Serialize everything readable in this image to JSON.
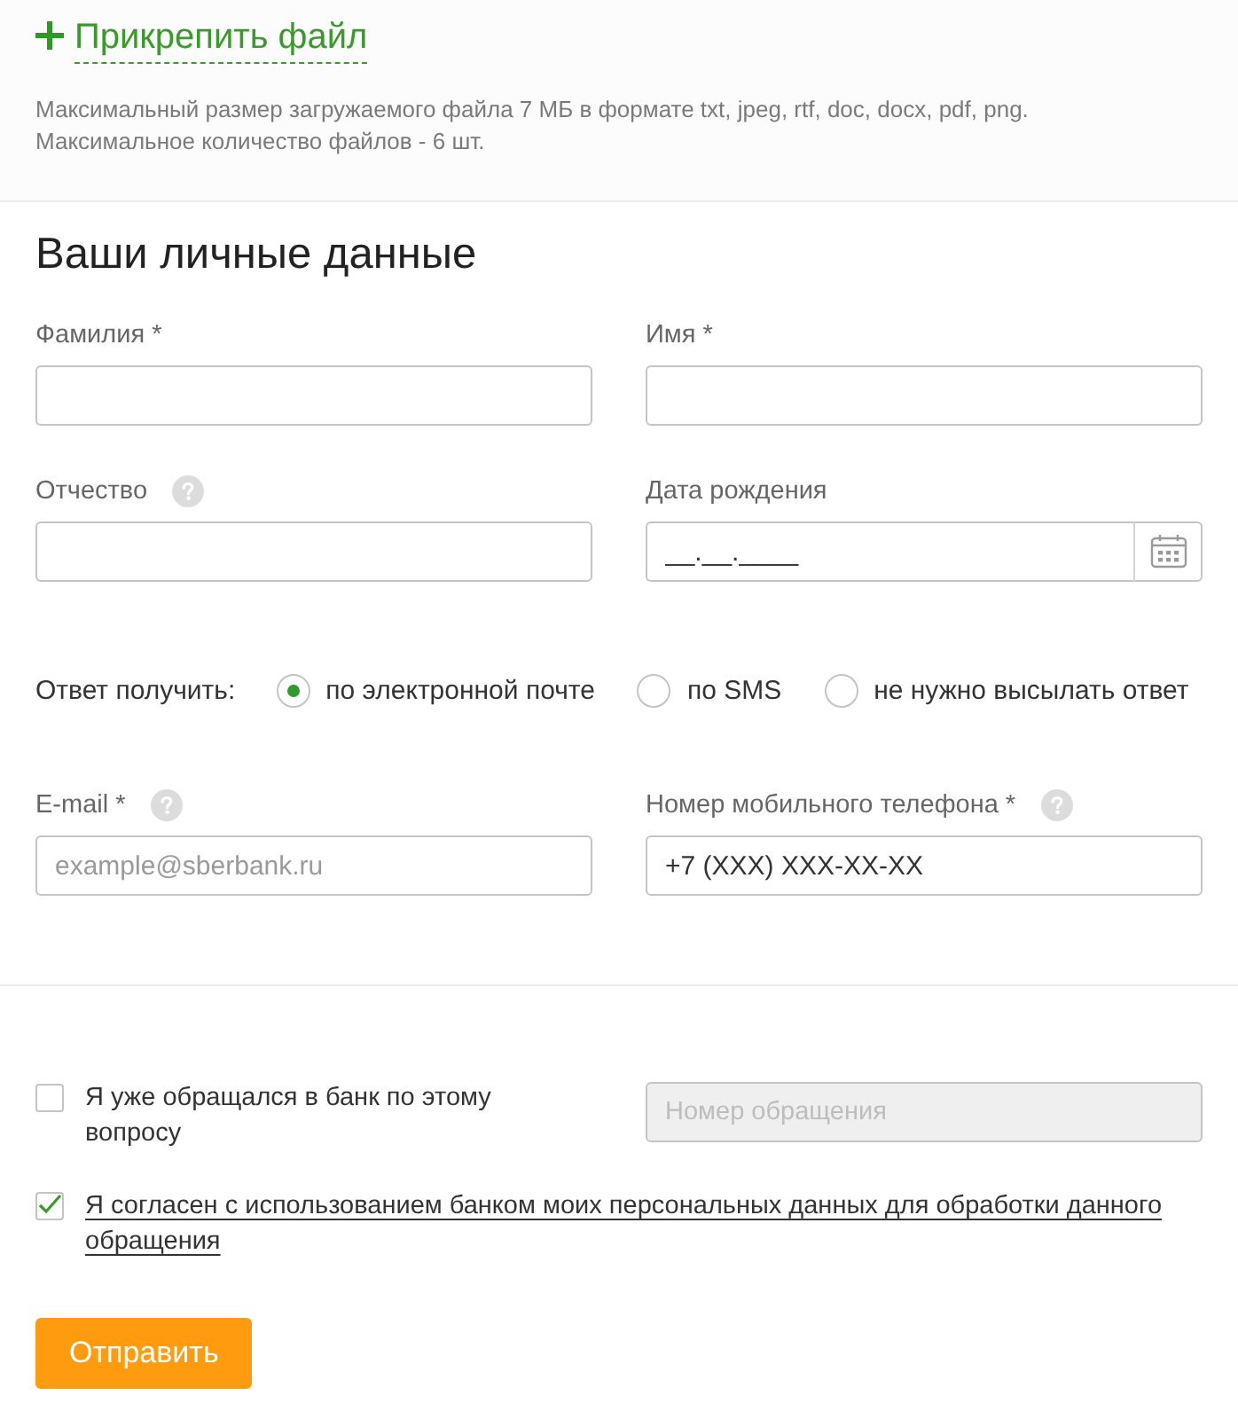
{
  "attach": {
    "label": "Прикрепить файл",
    "note": [
      "Максимальный размер загружаемого файла 7 МБ в формате txt, jpeg, rtf, doc, docx, pdf, png.",
      "Максимальное количество файлов - 6 шт."
    ]
  },
  "personal_data": {
    "title": "Ваши личные данные",
    "fields": [
      {
        "kind": "text",
        "label": "Фамилия *",
        "help": false
      },
      {
        "kind": "text",
        "label": "Имя *",
        "help": false
      },
      {
        "kind": "text",
        "label": "Отчество",
        "help": true
      },
      {
        "kind": "date",
        "label": "Дата рождения",
        "help": false,
        "value": "__.__.____"
      }
    ]
  },
  "reply": {
    "label": "Ответ получить:",
    "options": [
      {
        "label": "по электронной почте",
        "selected": true
      },
      {
        "label": "по SMS",
        "selected": false
      },
      {
        "label": "не нужно высылать ответ",
        "selected": false
      }
    ]
  },
  "contacts": {
    "fields": [
      {
        "kind": "text",
        "label": "E-mail *",
        "help": true,
        "placeholder": "example@sberbank.ru"
      },
      {
        "kind": "text",
        "label": "Номер мобильного телефона *",
        "help": true,
        "value": "+7 (XXX) XXX-XX-XX"
      }
    ]
  },
  "previous_request": {
    "label": "Я уже обращался в банк по этому вопросу",
    "checked": false
  },
  "request_number": {
    "placeholder": "Номер обращения",
    "disabled": true
  },
  "consent": {
    "label": "Я согласен с использованием банком моих персональных данных для обработки данного обращения",
    "checked": true
  },
  "submit": {
    "label": "Отправить"
  }
}
